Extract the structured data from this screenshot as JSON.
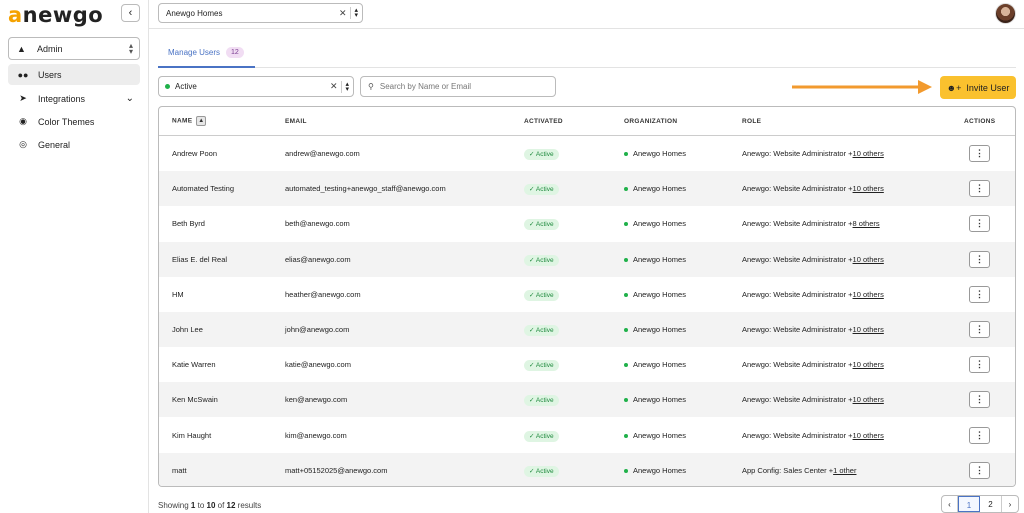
{
  "logo": {
    "part1": "a",
    "part2": "newgo"
  },
  "sidebar": {
    "collapse_icon": "chevron-left-icon",
    "org_label": "Admin",
    "items": [
      {
        "label": "Users",
        "icon": "users-icon"
      },
      {
        "label": "Integrations",
        "icon": "send-icon"
      },
      {
        "label": "Color Themes",
        "icon": "palette-icon"
      },
      {
        "label": "General",
        "icon": "globe-icon"
      }
    ]
  },
  "topbar": {
    "company": "Anewgo Homes"
  },
  "tabs": {
    "manage_users": "Manage Users",
    "count": "12"
  },
  "filters": {
    "status": "Active",
    "search_placeholder": "Search by Name or Email"
  },
  "invite_button": "Invite User",
  "table": {
    "headers": {
      "name": "NAME",
      "email": "EMAIL",
      "activated": "ACTIVATED",
      "organization": "ORGANIZATION",
      "role": "ROLE",
      "actions": "ACTIONS"
    },
    "rows": [
      {
        "name": "Andrew Poon",
        "email": "andrew@anewgo.com",
        "activated": "Active",
        "org": "Anewgo Homes",
        "role": "Anewgo: Website Administrator +",
        "role_link": "10 others"
      },
      {
        "name": "Automated Testing",
        "email": "automated_testing+anewgo_staff@anewgo.com",
        "activated": "Active",
        "org": "Anewgo Homes",
        "role": "Anewgo: Website Administrator +",
        "role_link": "10 others"
      },
      {
        "name": "Beth Byrd",
        "email": "beth@anewgo.com",
        "activated": "Active",
        "org": "Anewgo Homes",
        "role": "Anewgo: Website Administrator +",
        "role_link": "8 others"
      },
      {
        "name": "Elias E. del Real",
        "email": "elias@anewgo.com",
        "activated": "Active",
        "org": "Anewgo Homes",
        "role": "Anewgo: Website Administrator +",
        "role_link": "10 others"
      },
      {
        "name": "HM",
        "email": "heather@anewgo.com",
        "activated": "Active",
        "org": "Anewgo Homes",
        "role": "Anewgo: Website Administrator +",
        "role_link": "10 others"
      },
      {
        "name": "John Lee",
        "email": "john@anewgo.com",
        "activated": "Active",
        "org": "Anewgo Homes",
        "role": "Anewgo: Website Administrator +",
        "role_link": "10 others"
      },
      {
        "name": "Katie Warren",
        "email": "katie@anewgo.com",
        "activated": "Active",
        "org": "Anewgo Homes",
        "role": "Anewgo: Website Administrator +",
        "role_link": "10 others"
      },
      {
        "name": "Ken McSwain",
        "email": "ken@anewgo.com",
        "activated": "Active",
        "org": "Anewgo Homes",
        "role": "Anewgo: Website Administrator +",
        "role_link": "10 others"
      },
      {
        "name": "Kim Haught",
        "email": "kim@anewgo.com",
        "activated": "Active",
        "org": "Anewgo Homes",
        "role": "Anewgo: Website Administrator +",
        "role_link": "10 others"
      },
      {
        "name": "matt",
        "email": "matt+05152025@anewgo.com",
        "activated": "Active",
        "org": "Anewgo Homes",
        "role": "App Config: Sales Center +",
        "role_link": "1 other"
      }
    ]
  },
  "footer": {
    "showing_prefix": "Showing ",
    "from": "1",
    "to_word": " to ",
    "to": "10",
    "of_word": " of ",
    "total": "12",
    "suffix": " results"
  },
  "pagination": {
    "prev": "‹",
    "pages": [
      "1",
      "2"
    ],
    "next": "›"
  },
  "colors": {
    "accent": "#4a73c4",
    "invite": "#fac12e",
    "active_green": "#20b14a",
    "arrow": "#f29a2e"
  }
}
